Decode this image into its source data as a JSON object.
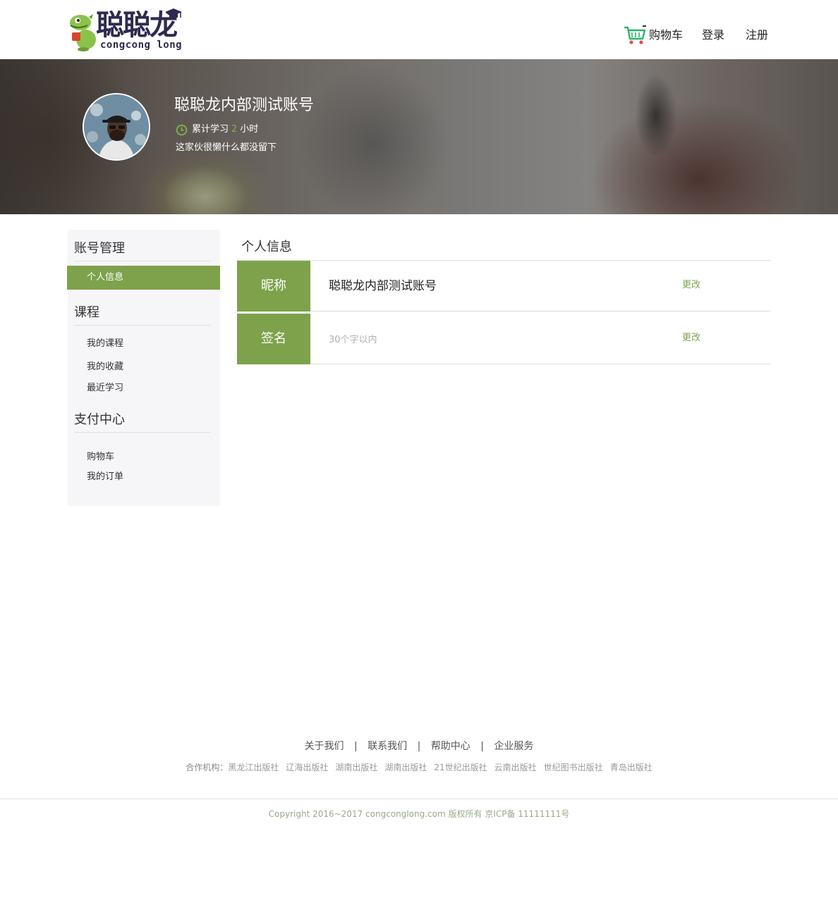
{
  "header": {
    "logo_text": "聪聪龙",
    "logo_subtext": "congcong long",
    "cart_label": "购物车",
    "login_label": "登录",
    "register_label": "注册"
  },
  "profile": {
    "name": "聪聪龙内部测试账号",
    "study_prefix": "累计学习",
    "study_hours": "2",
    "study_unit": "小时",
    "motto": "这家伙很懒什么都没留下"
  },
  "sidebar": {
    "sections": [
      {
        "title": "账号管理",
        "items": [
          {
            "label": "个人信息",
            "active": true
          }
        ]
      },
      {
        "title": "课程",
        "items": [
          {
            "label": "我的课程"
          },
          {
            "label": "我的收藏"
          },
          {
            "label": "最近学习"
          }
        ]
      },
      {
        "title": "支付中心",
        "items": [
          {
            "label": "购物车"
          },
          {
            "label": "我的订单"
          }
        ]
      }
    ]
  },
  "main": {
    "title": "个人信息",
    "rows": [
      {
        "label": "昵称",
        "value": "聪聪龙内部测试账号",
        "action": "更改"
      },
      {
        "label": "签名",
        "placeholder": "30个字以内",
        "action": "更改"
      }
    ]
  },
  "footer": {
    "links": [
      "关于我们",
      "联系我们",
      "帮助中心",
      "企业服务"
    ],
    "separator": "|",
    "partners_label": "合作机构：",
    "partners": [
      "黑龙江出版社",
      "辽海出版社",
      "湖南出版社",
      "湖南出版社",
      "21世纪出版社",
      "云南出版社",
      "世纪图书出版社",
      "青岛出版社"
    ],
    "copyright": "Copyright 2016~2017 congconglong.com 版权所有 京ICP备 11111111号"
  },
  "colors": {
    "accent_green": "#7da24b",
    "logo_navy": "#2e2a4f",
    "cart_green": "#2db36a"
  }
}
